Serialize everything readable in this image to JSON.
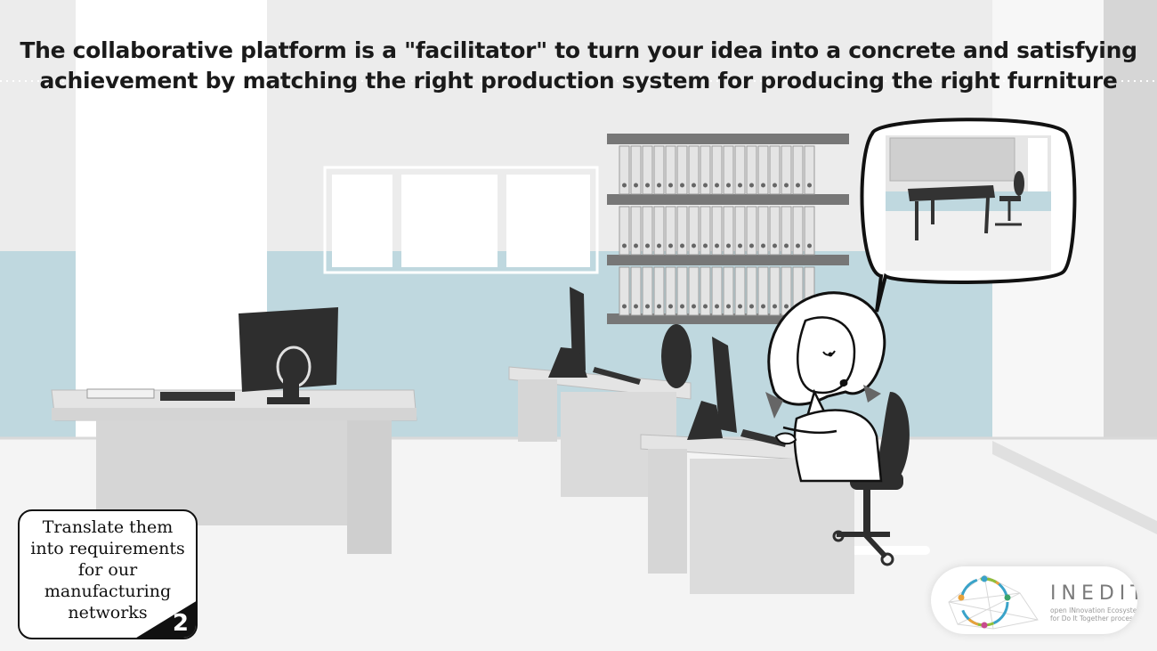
{
  "caption": {
    "line1": "The collaborative platform is a \"facilitator\" to turn your idea into a concrete and satisfying",
    "line2": "achievement by matching the right production system for producing the right furniture"
  },
  "step_card": {
    "text_lines": [
      "Translate them",
      "into requirements",
      "for our",
      "manufacturing",
      "networks"
    ],
    "step_number": "2"
  },
  "logo": {
    "wordmark": "INEDIT",
    "tagline_line1": "open INnovation Ecosystem",
    "tagline_line2": "for Do It Together process"
  },
  "colors": {
    "wall_band": "#bfd8df",
    "wall": "#ececec",
    "floor": "#f4f4f4",
    "furniture": "#e2e2e2",
    "monitor": "#2e2e2e",
    "ink": "#111111"
  },
  "scene": {
    "icons": [
      "office-illustration",
      "desk",
      "monitor",
      "bookshelf",
      "window",
      "office-chair",
      "woman-character",
      "thought-bubble"
    ]
  }
}
